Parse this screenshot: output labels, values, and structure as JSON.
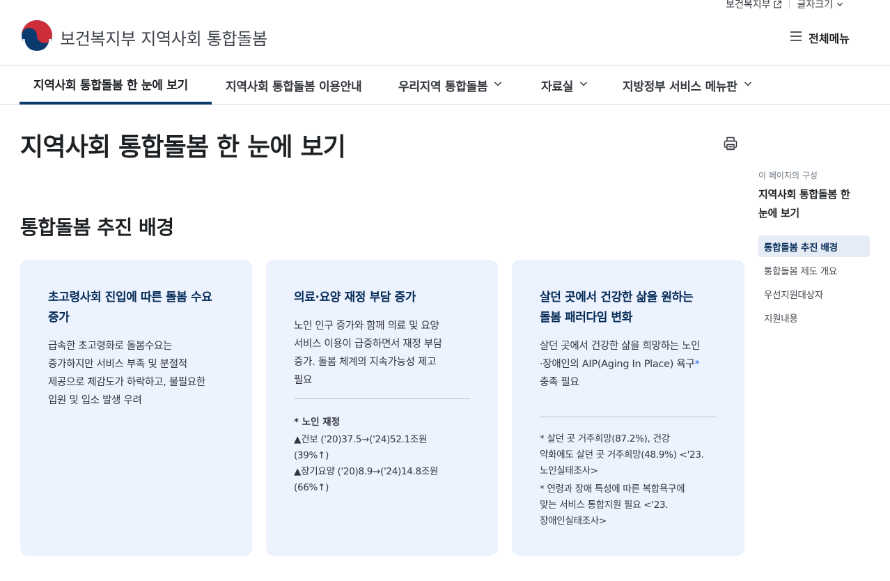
{
  "utility": {
    "ministry_link": "보건복지부",
    "font_size": "글자크기"
  },
  "header": {
    "logo_text": "보건복지부 지역사회 통합돌봄",
    "menu_label": "전체메뉴"
  },
  "gnb": {
    "items": [
      {
        "label": "지역사회 통합돌봄 한 눈에 보기",
        "active": true,
        "dropdown": false
      },
      {
        "label": "지역사회 통합돌봄 이용안내",
        "active": false,
        "dropdown": false
      },
      {
        "label": "우리지역 통합돌봄",
        "active": false,
        "dropdown": true
      },
      {
        "label": "자료실",
        "active": false,
        "dropdown": true
      },
      {
        "label": "지방정부 서비스 메뉴판",
        "active": false,
        "dropdown": true
      }
    ]
  },
  "page": {
    "title": "지역사회 통합돌봄 한 눈에 보기",
    "section_title": "통합돌봄 추진 배경"
  },
  "cards": [
    {
      "title_line1": "초고령사회 진입에 따른 돌봄 수요",
      "title_line2": "증가",
      "desc_lines": [
        "급속한 초고령화로 돌봄수요는",
        "증가하지만 서비스 부족 및 분절적",
        "제공으로 체감도가 하락하고, 불필요한",
        "입원 및 입소 발생 우려"
      ]
    },
    {
      "title_line1": "의료·요양 재정 부담 증가",
      "desc_lines": [
        "노인 인구 증가와 함께 의료 및 요양",
        "서비스 이용이 급증하면서 재정 부담",
        "증가. 돌봄 체계의 지속가능성 제고",
        "필요"
      ],
      "note_title": "* 노인 재정",
      "notes": [
        "▲건보 ('20)37.5→('24)52.1조원",
        "(39%↑)",
        "▲장기요양 ('20)8.9→('24)14.8조원",
        "(66%↑)"
      ]
    },
    {
      "title_line1": "살던 곳에서 건강한 삶을 원하는",
      "title_line2": "돌봄 패러다임 변화",
      "desc_line1": "살던 곳에서 건강한 삶을 희망하는 노인",
      "desc_line2": "·장애인의 AIP(Aging In Place) 욕구",
      "desc_star": "*",
      "desc_line3": "충족 필요",
      "notes1": [
        "* 살던 곳 거주희망(87.2%), 건강",
        "악화에도 살던 곳 거주희망(48.9%) <'23.",
        "노인실태조사>"
      ],
      "notes2": [
        "* 연령과 장애 특성에 따른 복합욕구에",
        "맞는 서비스 통합지원 필요 <'23.",
        "장애인실태조사>"
      ]
    }
  ],
  "sidenav": {
    "label": "이 페이지의 구성",
    "title_line1": "지역사회 통합돌봄 한",
    "title_line2": "눈에 보기",
    "items": [
      "통합돌봄 추진 배경",
      "통합돌봄 제도 개요",
      "우선지원대상자",
      "지원내용"
    ]
  },
  "colors": {
    "brand_navy": "#0b3a6e",
    "card_bg": "#ecf2fe",
    "card_title": "#052b57",
    "accent_blue": "#256ef4"
  }
}
